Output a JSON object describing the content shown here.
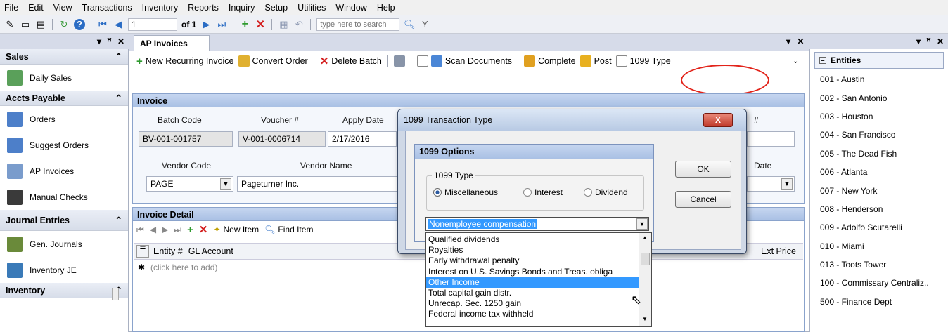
{
  "menu": [
    "File",
    "Edit",
    "View",
    "Transactions",
    "Inventory",
    "Reports",
    "Inquiry",
    "Setup",
    "Utilities",
    "Window",
    "Help"
  ],
  "toolbar": {
    "record_value": "1",
    "of_label": "of 1",
    "search_placeholder": "type here to search"
  },
  "left_panel": {
    "sections": [
      {
        "title": "Sales",
        "items": [
          {
            "label": "Daily Sales",
            "icon": "sales-icon",
            "color": "#5aa05a"
          }
        ]
      },
      {
        "title": "Accts Payable",
        "items": [
          {
            "label": "Orders",
            "icon": "orders-icon",
            "color": "#4d7fc9"
          },
          {
            "label": "Suggest Orders",
            "icon": "suggest-orders-icon",
            "color": "#4d7fc9"
          },
          {
            "label": "AP Invoices",
            "icon": "ap-invoices-icon",
            "color": "#7a9ccc"
          },
          {
            "label": "Manual Checks",
            "icon": "manual-checks-icon",
            "color": "#3a3a3a"
          }
        ]
      },
      {
        "title": "Journal Entries",
        "items": [
          {
            "label": "Gen. Journals",
            "icon": "gen-journals-icon",
            "color": "#6a8a3a"
          },
          {
            "label": "Inventory JE",
            "icon": "inventory-je-icon",
            "color": "#3a7ab8"
          }
        ]
      },
      {
        "title": "Inventory",
        "items": []
      }
    ]
  },
  "tab": {
    "title": "AP Invoices"
  },
  "actions": {
    "new_recurring": "New Recurring Invoice",
    "convert_order": "Convert Order",
    "delete_batch": "Delete Batch",
    "scan_documents": "Scan Documents",
    "complete": "Complete",
    "post": "Post",
    "type_1099": "1099 Type"
  },
  "invoice": {
    "section_title": "Invoice",
    "batch_code_label": "Batch Code",
    "batch_code": "BV-001-001757",
    "voucher_label": "Voucher #",
    "voucher": "V-001-0006714",
    "apply_date_label": "Apply Date",
    "apply_date": "2/17/2016",
    "hash_label": "#",
    "vendor_code_label": "Vendor Code",
    "vendor_code": "PAGE",
    "vendor_name_label": "Vendor Name",
    "vendor_name": "Pageturner Inc.",
    "date_label": "Date"
  },
  "invoice_detail": {
    "section_title": "Invoice Detail",
    "new_item": "New Item",
    "find_item": "Find Item",
    "columns": [
      "Entity #",
      "GL Account",
      "Ext Price"
    ],
    "add_row": "(click here to add)"
  },
  "dialog": {
    "title": "1099 Transaction Type",
    "options_title": "1099 Options",
    "group_label": "1099 Type",
    "radios": [
      {
        "label": "Miscellaneous",
        "checked": true
      },
      {
        "label": "Interest",
        "checked": false
      },
      {
        "label": "Dividend",
        "checked": false
      }
    ],
    "selected_value": "Nonemployee compensation",
    "ok": "OK",
    "cancel": "Cancel",
    "close": "X",
    "list": [
      "Qualified dividends",
      "Royalties",
      "Early withdrawal penalty",
      "Interest on U.S. Savings Bonds and Treas. obliga",
      "Other Income",
      "Total capital gain distr.",
      "Unrecap. Sec. 1250 gain",
      "Federal income tax withheld"
    ],
    "highlighted_index": 4
  },
  "entities": {
    "title": "Entities",
    "items": [
      "001 - Austin",
      "002 - San Antonio",
      "003 - Houston",
      "004 - San Francisco",
      "005 - The Dead Fish",
      "006 - Atlanta",
      "007 - New York",
      "008 - Henderson",
      "009 - Adolfo Scutarelli",
      "010 - Miami",
      "013 - Toots Tower",
      "100 - Commissary Centraliz..",
      "500 - Finance Dept"
    ]
  },
  "colors": {
    "annotation_red": "#e2231a",
    "selection_blue": "#3399ff",
    "section_blue": "#a9c0e4"
  }
}
